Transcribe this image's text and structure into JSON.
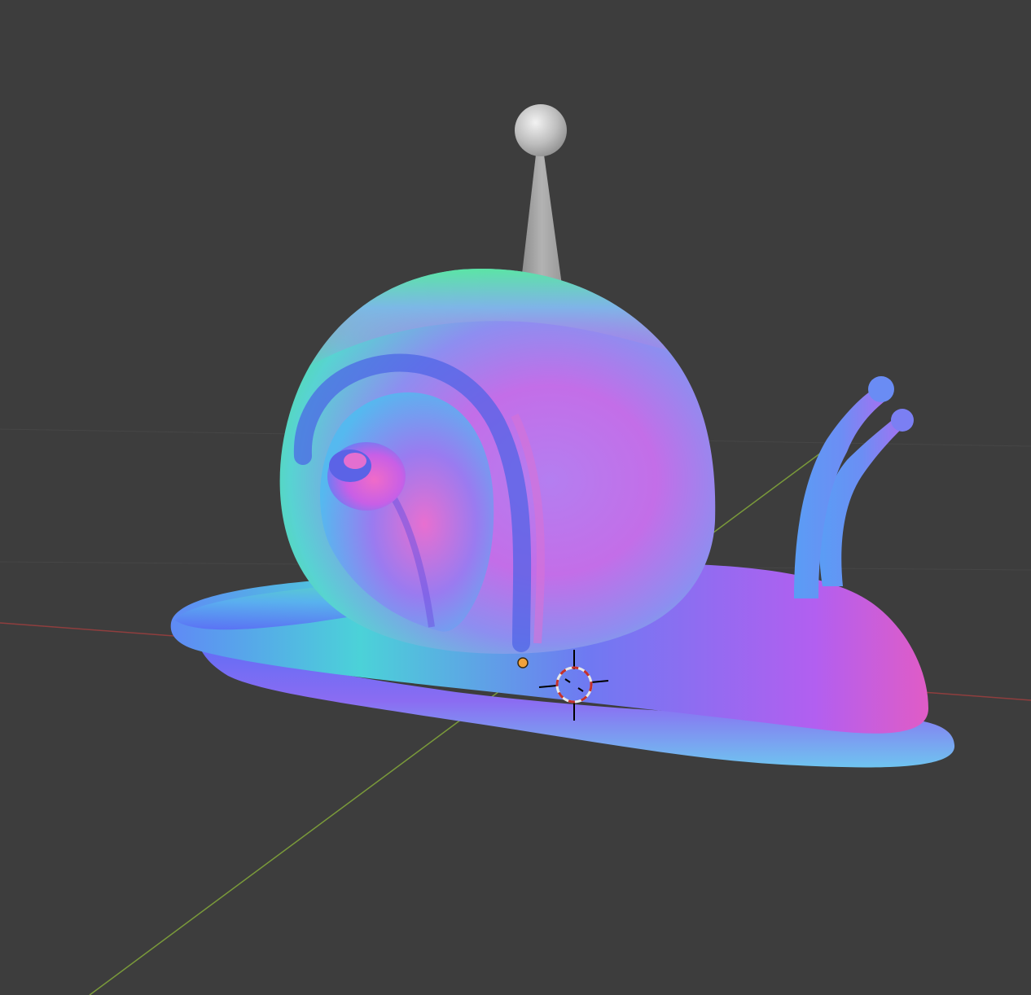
{
  "viewport": {
    "background_color": "#3d3d3d",
    "grid_line_color": "#464646",
    "x_axis_color": "#8f3e3e",
    "y_axis_color": "#7a9a3a",
    "selection_origin_color": "#f2a23c",
    "cursor_colors": [
      "#d9d9d9",
      "#c4302b",
      "#000000"
    ],
    "objects": [
      {
        "name": "snail",
        "shading": "normal-map"
      },
      {
        "name": "light-gizmo"
      }
    ],
    "icons": [
      "3d-cursor-icon",
      "origin-point-icon"
    ]
  }
}
